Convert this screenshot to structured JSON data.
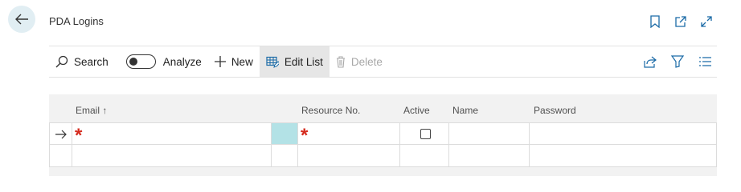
{
  "page": {
    "title": "PDA Logins",
    "back_icon": "arrow-left-icon",
    "header_icons": [
      "bookmark-icon",
      "open-new-window-icon",
      "expand-icon"
    ]
  },
  "actions": {
    "search": "Search",
    "analyze": "Analyze",
    "analyze_toggle_on": false,
    "new": "New",
    "edit_list": "Edit List",
    "delete": "Delete",
    "right_icons": [
      "share-icon",
      "filter-icon",
      "list-view-icon"
    ]
  },
  "table": {
    "columns": {
      "email": "Email",
      "email_sort": "↑",
      "resource_no": "Resource No.",
      "active": "Active",
      "name": "Name",
      "password": "Password"
    },
    "rows": [
      {
        "selected": true,
        "email": "",
        "resource_no": "",
        "active": false,
        "name": "",
        "password": "",
        "required_marker": "*"
      },
      {
        "selected": false,
        "email": "",
        "resource_no": "",
        "active": null,
        "name": "",
        "password": ""
      }
    ]
  },
  "colors": {
    "accent": "#b3e2e6",
    "required": "#d52b1e",
    "back_button_bg": "#e1eef3"
  }
}
